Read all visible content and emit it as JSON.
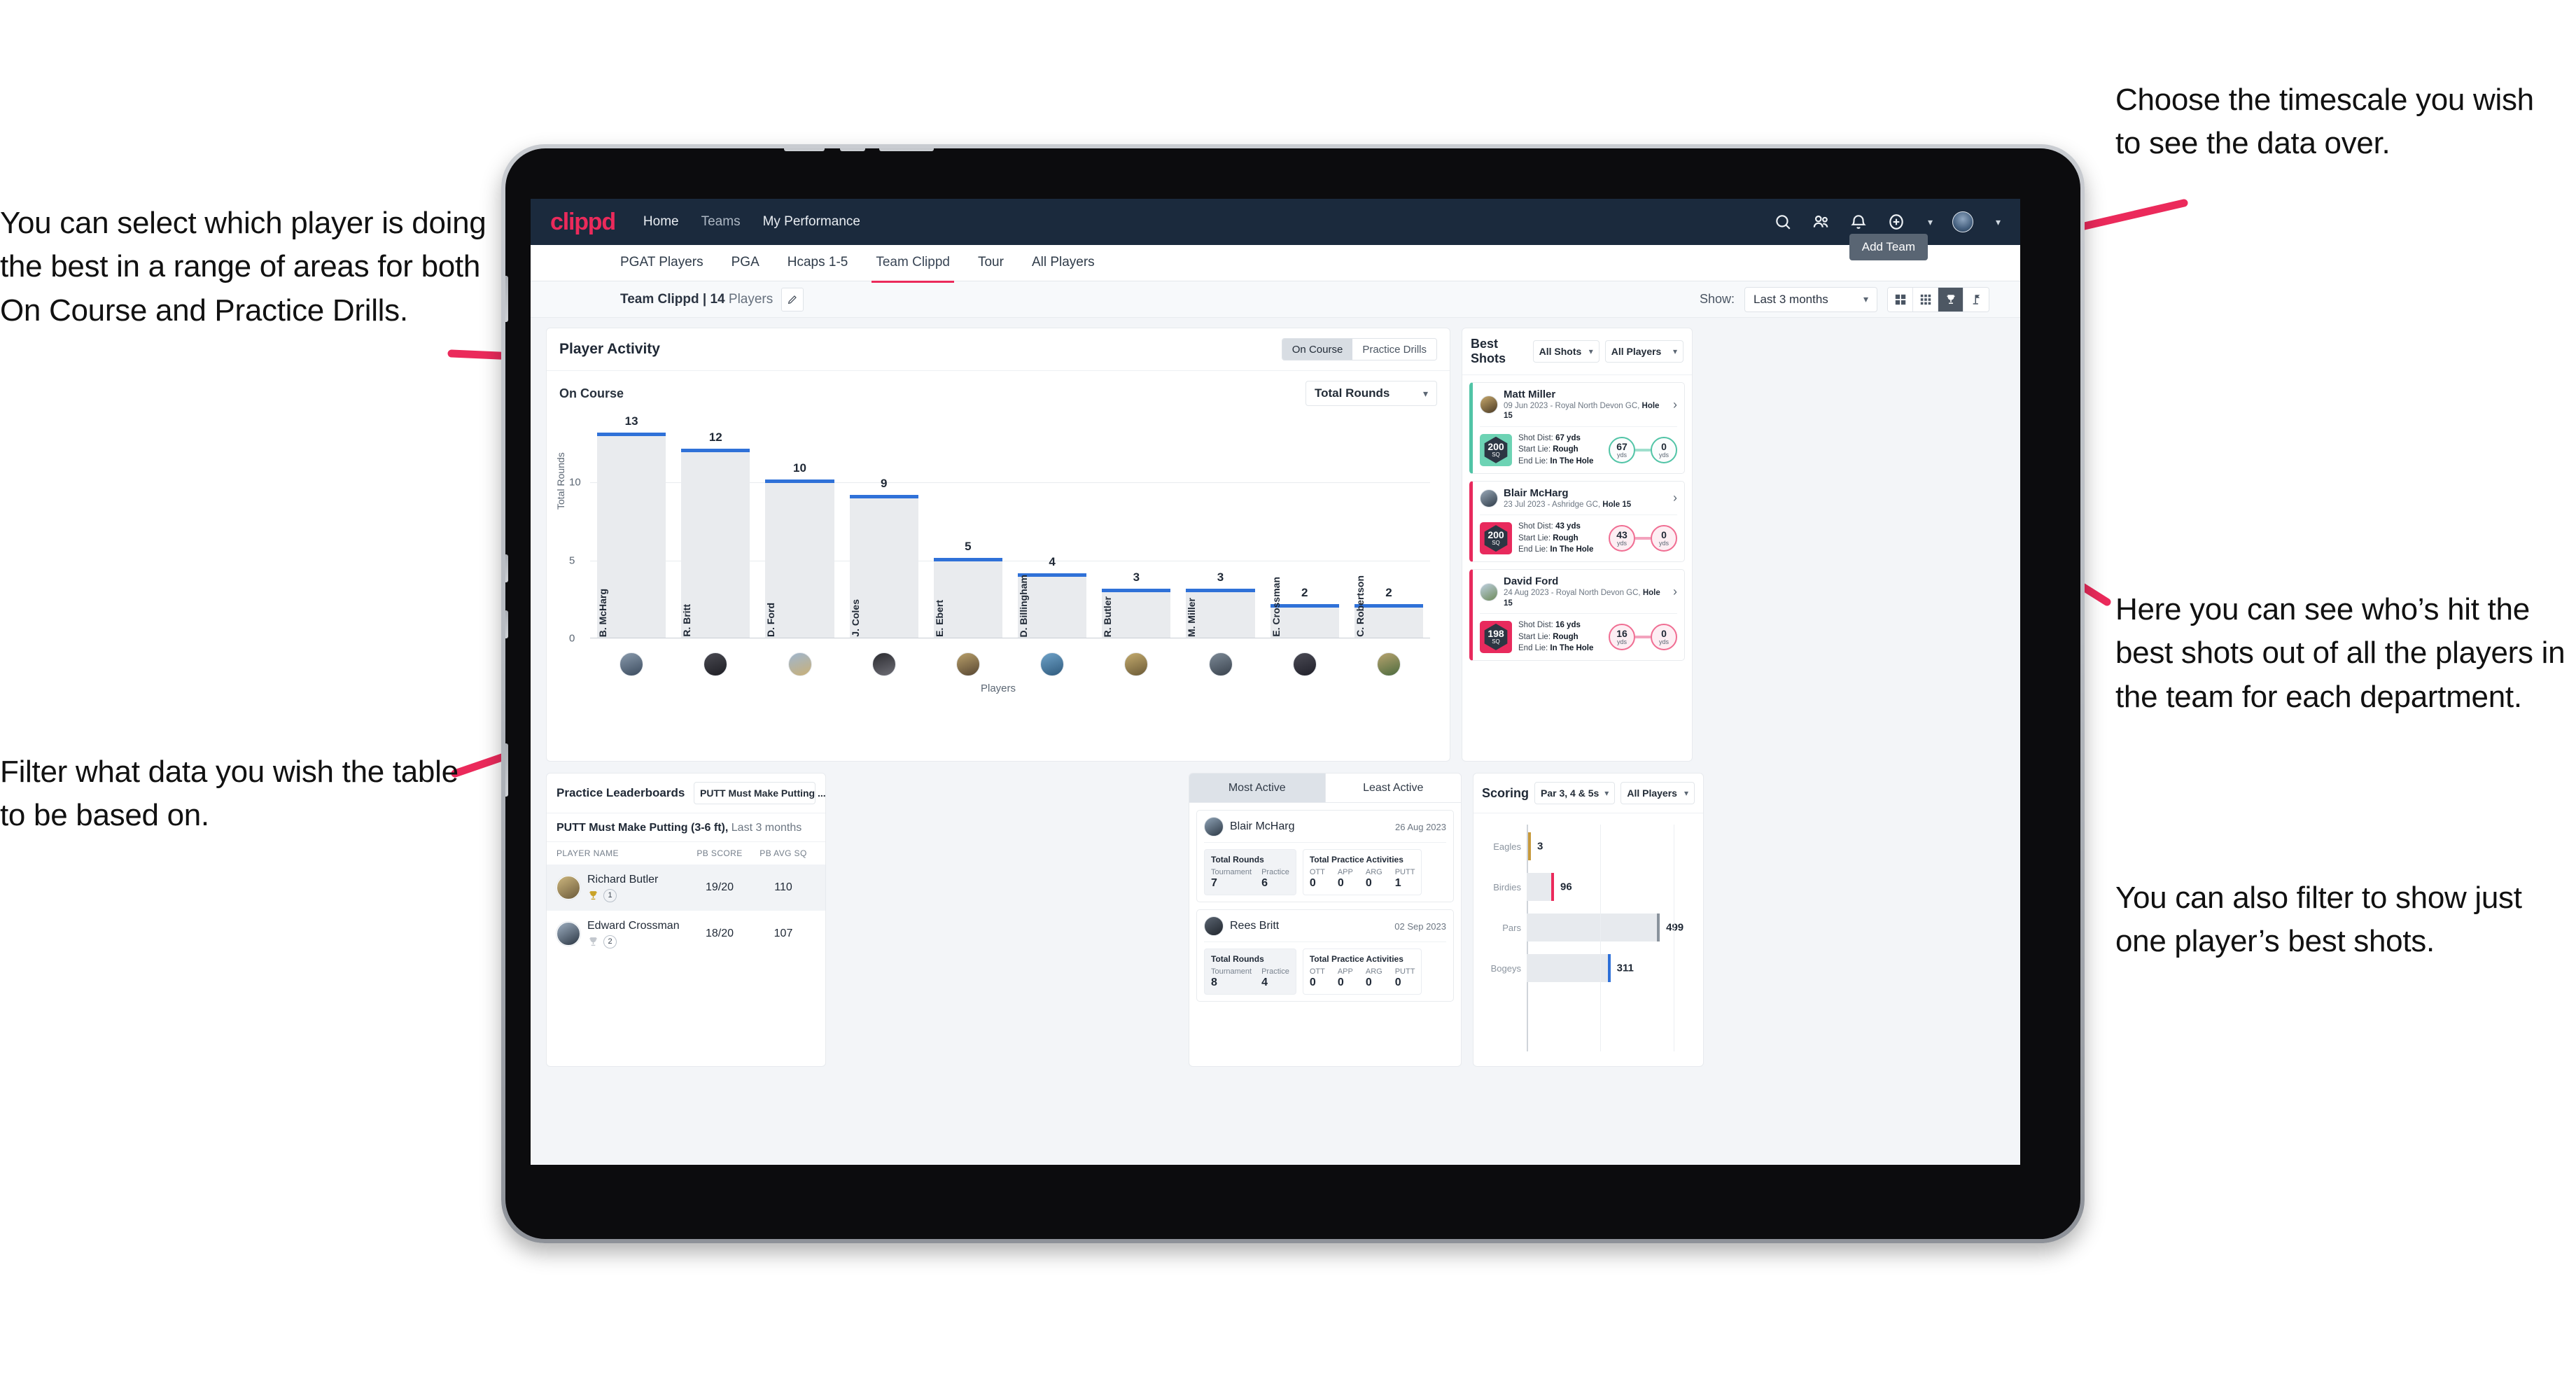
{
  "annotations": {
    "left_top": "You can select which player is doing the best in a range of areas for both On Course and Practice Drills.",
    "left_bottom": "Filter what data you wish the table to be based on.",
    "right_top": "Choose the timescale you wish to see the data over.",
    "right_mid": "Here you can see who’s hit the best shots out of all the players in the team for each department.",
    "right_bottom": "You can also filter to show just one player’s best shots."
  },
  "topnav": {
    "logo": "clippd",
    "links": [
      "Home",
      "Teams",
      "My Performance"
    ],
    "icons": [
      "search-icon",
      "people-icon",
      "bell-icon",
      "plus-circle-icon",
      "avatar-icon"
    ]
  },
  "tabbar": {
    "tabs": [
      "PGAT Players",
      "PGA",
      "Hcaps 1-5",
      "Team Clippd",
      "Tour",
      "All Players"
    ],
    "active": "Team Clippd",
    "add_team_label": "Add Team"
  },
  "subbar": {
    "team_name": "Team Clippd",
    "team_separator": " | ",
    "team_count": "14",
    "team_players_word": " Players",
    "show_label": "Show:",
    "timescale_value": "Last 3 months",
    "view_toggles": [
      "grid-4-icon",
      "grid-9-icon",
      "trophy-icon",
      "flag-icon"
    ],
    "view_active_index": 2
  },
  "player_activity": {
    "title": "Player Activity",
    "segments": [
      "On Course",
      "Practice Drills"
    ],
    "segment_active": "On Course",
    "section_label": "On Course",
    "metric_select": "Total Rounds"
  },
  "chart_data": {
    "type": "bar",
    "title": "Player Activity — On Course",
    "xlabel": "Players",
    "ylabel": "Total Rounds",
    "ylim": [
      0,
      14
    ],
    "yticks": [
      0,
      5,
      10
    ],
    "grid": true,
    "categories": [
      "B. McHarg",
      "R. Britt",
      "D. Ford",
      "J. Coles",
      "E. Ebert",
      "D. Billingham",
      "R. Butler",
      "M. Miller",
      "E. Crossman",
      "C. Robertson"
    ],
    "values": [
      13,
      12,
      10,
      9,
      5,
      4,
      3,
      3,
      2,
      2
    ]
  },
  "best_shots": {
    "title": "Best Shots",
    "filter_shots": "All Shots",
    "filter_players": "All Players",
    "shots": [
      {
        "player": "Matt Miller",
        "meta_prefix": "09 Jun 2023 - Royal North Devon GC, ",
        "hole": "Hole 15",
        "sq": "200",
        "sq_unit": "SQ",
        "shot_dist_label": "Shot Dist: ",
        "shot_dist": "67 yds",
        "start_lie_label": "Start Lie: ",
        "start_lie": "Rough",
        "end_lie_label": "End Lie: ",
        "end_lie": "In The Hole",
        "from_val": "67",
        "from_unit": "yds",
        "to_val": "0",
        "to_unit": "yds",
        "accent": "#51c4a6",
        "theme": "teal"
      },
      {
        "player": "Blair McHarg",
        "meta_prefix": "23 Jul 2023 - Ashridge GC, ",
        "hole": "Hole 15",
        "sq": "200",
        "sq_unit": "SQ",
        "shot_dist_label": "Shot Dist: ",
        "shot_dist": "43 yds",
        "start_lie_label": "Start Lie: ",
        "start_lie": "Rough",
        "end_lie_label": "End Lie: ",
        "end_lie": "In The Hole",
        "from_val": "43",
        "from_unit": "yds",
        "to_val": "0",
        "to_unit": "yds",
        "accent": "#e82a5d",
        "theme": "pink"
      },
      {
        "player": "David Ford",
        "meta_prefix": "24 Aug 2023 - Royal North Devon GC, ",
        "hole": "Hole 15",
        "sq": "198",
        "sq_unit": "SQ",
        "shot_dist_label": "Shot Dist: ",
        "shot_dist": "16 yds",
        "start_lie_label": "Start Lie: ",
        "start_lie": "Rough",
        "end_lie_label": "End Lie: ",
        "end_lie": "In The Hole",
        "from_val": "16",
        "from_unit": "yds",
        "to_val": "0",
        "to_unit": "yds",
        "accent": "#e82a5d",
        "theme": "pink"
      }
    ]
  },
  "practice_leaderboards": {
    "title": "Practice Leaderboards",
    "drill_select": "PUTT Must Make Putting ...",
    "subtitle_bold": "PUTT Must Make Putting (3-6 ft),",
    "subtitle_light": " Last 3 months",
    "columns": [
      "PLAYER NAME",
      "PB SCORE",
      "PB AVG SQ"
    ],
    "rows": [
      {
        "name": "Richard Butler",
        "rank": "1",
        "trophy": "gold",
        "pb_score": "19/20",
        "pb_avg_sq": "110"
      },
      {
        "name": "Edward Crossman",
        "rank": "2",
        "trophy": "silver",
        "pb_score": "18/20",
        "pb_avg_sq": "107"
      }
    ]
  },
  "activity": {
    "tabs": [
      "Most Active",
      "Least Active"
    ],
    "active_tab": "Most Active",
    "rounds_title": "Total Rounds",
    "rounds_cols": [
      "Tournament",
      "Practice"
    ],
    "practice_title": "Total Practice Activities",
    "practice_cols": [
      "OTT",
      "APP",
      "ARG",
      "PUTT"
    ],
    "entries": [
      {
        "name": "Blair McHarg",
        "date": "26 Aug 2023",
        "tournament": "7",
        "practice": "6",
        "ott": "0",
        "app": "0",
        "arg": "0",
        "putt": "1"
      },
      {
        "name": "Rees Britt",
        "date": "02 Sep 2023",
        "tournament": "8",
        "practice": "4",
        "ott": "0",
        "app": "0",
        "arg": "0",
        "putt": "0"
      }
    ]
  },
  "scoring": {
    "title": "Scoring",
    "filter_par": "Par 3, 4 & 5s",
    "filter_players": "All Players"
  },
  "scoring_chart": {
    "type": "bar",
    "orientation": "horizontal",
    "title": "Scoring",
    "categories": [
      "Eagles",
      "Birdies",
      "Pars",
      "Bogeys"
    ],
    "values": [
      3,
      96,
      499,
      311
    ],
    "colors": [
      "#c79a3c",
      "#eb2a5b",
      "#8a939d",
      "#2f71d8"
    ],
    "xmax": 560,
    "grid": true
  },
  "colors": {
    "brand_pink": "#eb2a5b",
    "nav_dark": "#1b2a3d",
    "bar_blue": "#2f71d8",
    "teal": "#51c4a6",
    "page_bg": "#f3f5f8"
  }
}
